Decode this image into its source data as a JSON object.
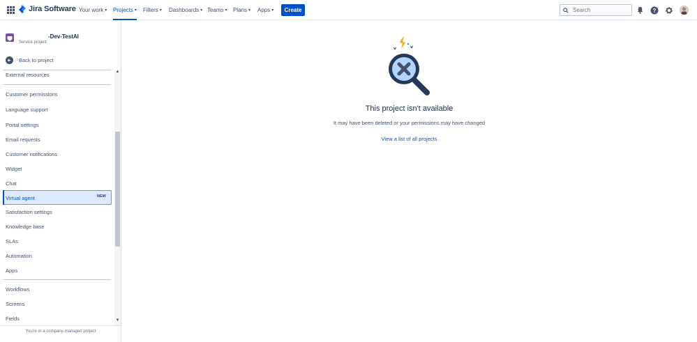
{
  "header": {
    "logo_text": "Jira Software",
    "nav": [
      {
        "label": "Your work"
      },
      {
        "label": "Projects"
      },
      {
        "label": "Filters"
      },
      {
        "label": "Dashboards"
      },
      {
        "label": "Teams"
      },
      {
        "label": "Plans"
      },
      {
        "label": "Apps"
      }
    ],
    "create_label": "Create",
    "search_placeholder": "Search",
    "accent": "#0052cc"
  },
  "sidebar": {
    "project_name": "-Dev-TestAI",
    "project_type": "Service project",
    "back_label": "Back to project",
    "items": [
      {
        "label": "External resources"
      },
      {
        "label": "Customer permissions"
      },
      {
        "label": "Language support"
      },
      {
        "label": "Portal settings"
      },
      {
        "label": "Email requests"
      },
      {
        "label": "Customer notifications"
      },
      {
        "label": "Widget"
      },
      {
        "label": "Chat"
      },
      {
        "label": "Virtual agent",
        "badge": "NEW",
        "selected": true
      },
      {
        "label": "Satisfaction settings"
      },
      {
        "label": "Knowledge base"
      },
      {
        "label": "SLAs"
      },
      {
        "label": "Automation"
      },
      {
        "label": "Apps"
      },
      {
        "label": "Workflows"
      },
      {
        "label": "Screens"
      },
      {
        "label": "Fields"
      }
    ],
    "footer": "You're in a company-managed project"
  },
  "main": {
    "icon": "magnifier-x-icon",
    "title": "This project isn't available",
    "description": "It may have been deleted or your permissions may have changed",
    "link": "View a list of all projects"
  }
}
